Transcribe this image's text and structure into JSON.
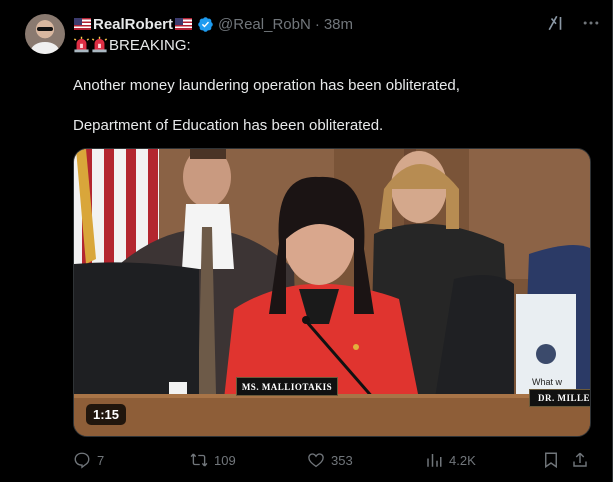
{
  "tweet": {
    "author": {
      "display_name": "RealRobert",
      "handle": "@Real_RobN",
      "separator": "·",
      "time": "38m",
      "verified": true,
      "verified_color": "#1d9bf0",
      "name_flags": "us-flag-icon"
    },
    "lines": [
      "BREAKING:",
      "Another money laundering operation has been obliterated,",
      "Department of Education has been obliterated."
    ],
    "media": {
      "type": "video",
      "duration": "1:15",
      "nameplate_left": "MS. MALLIOTAKIS",
      "nameplate_right": "DR. MILLER",
      "sign_text": "What w"
    },
    "metrics": {
      "replies": "7",
      "reposts": "109",
      "likes": "353",
      "views": "4.2K"
    }
  },
  "colors": {
    "background": "#000000",
    "text": "#e7e9ea",
    "muted": "#71767b",
    "accent": "#1d9bf0"
  }
}
